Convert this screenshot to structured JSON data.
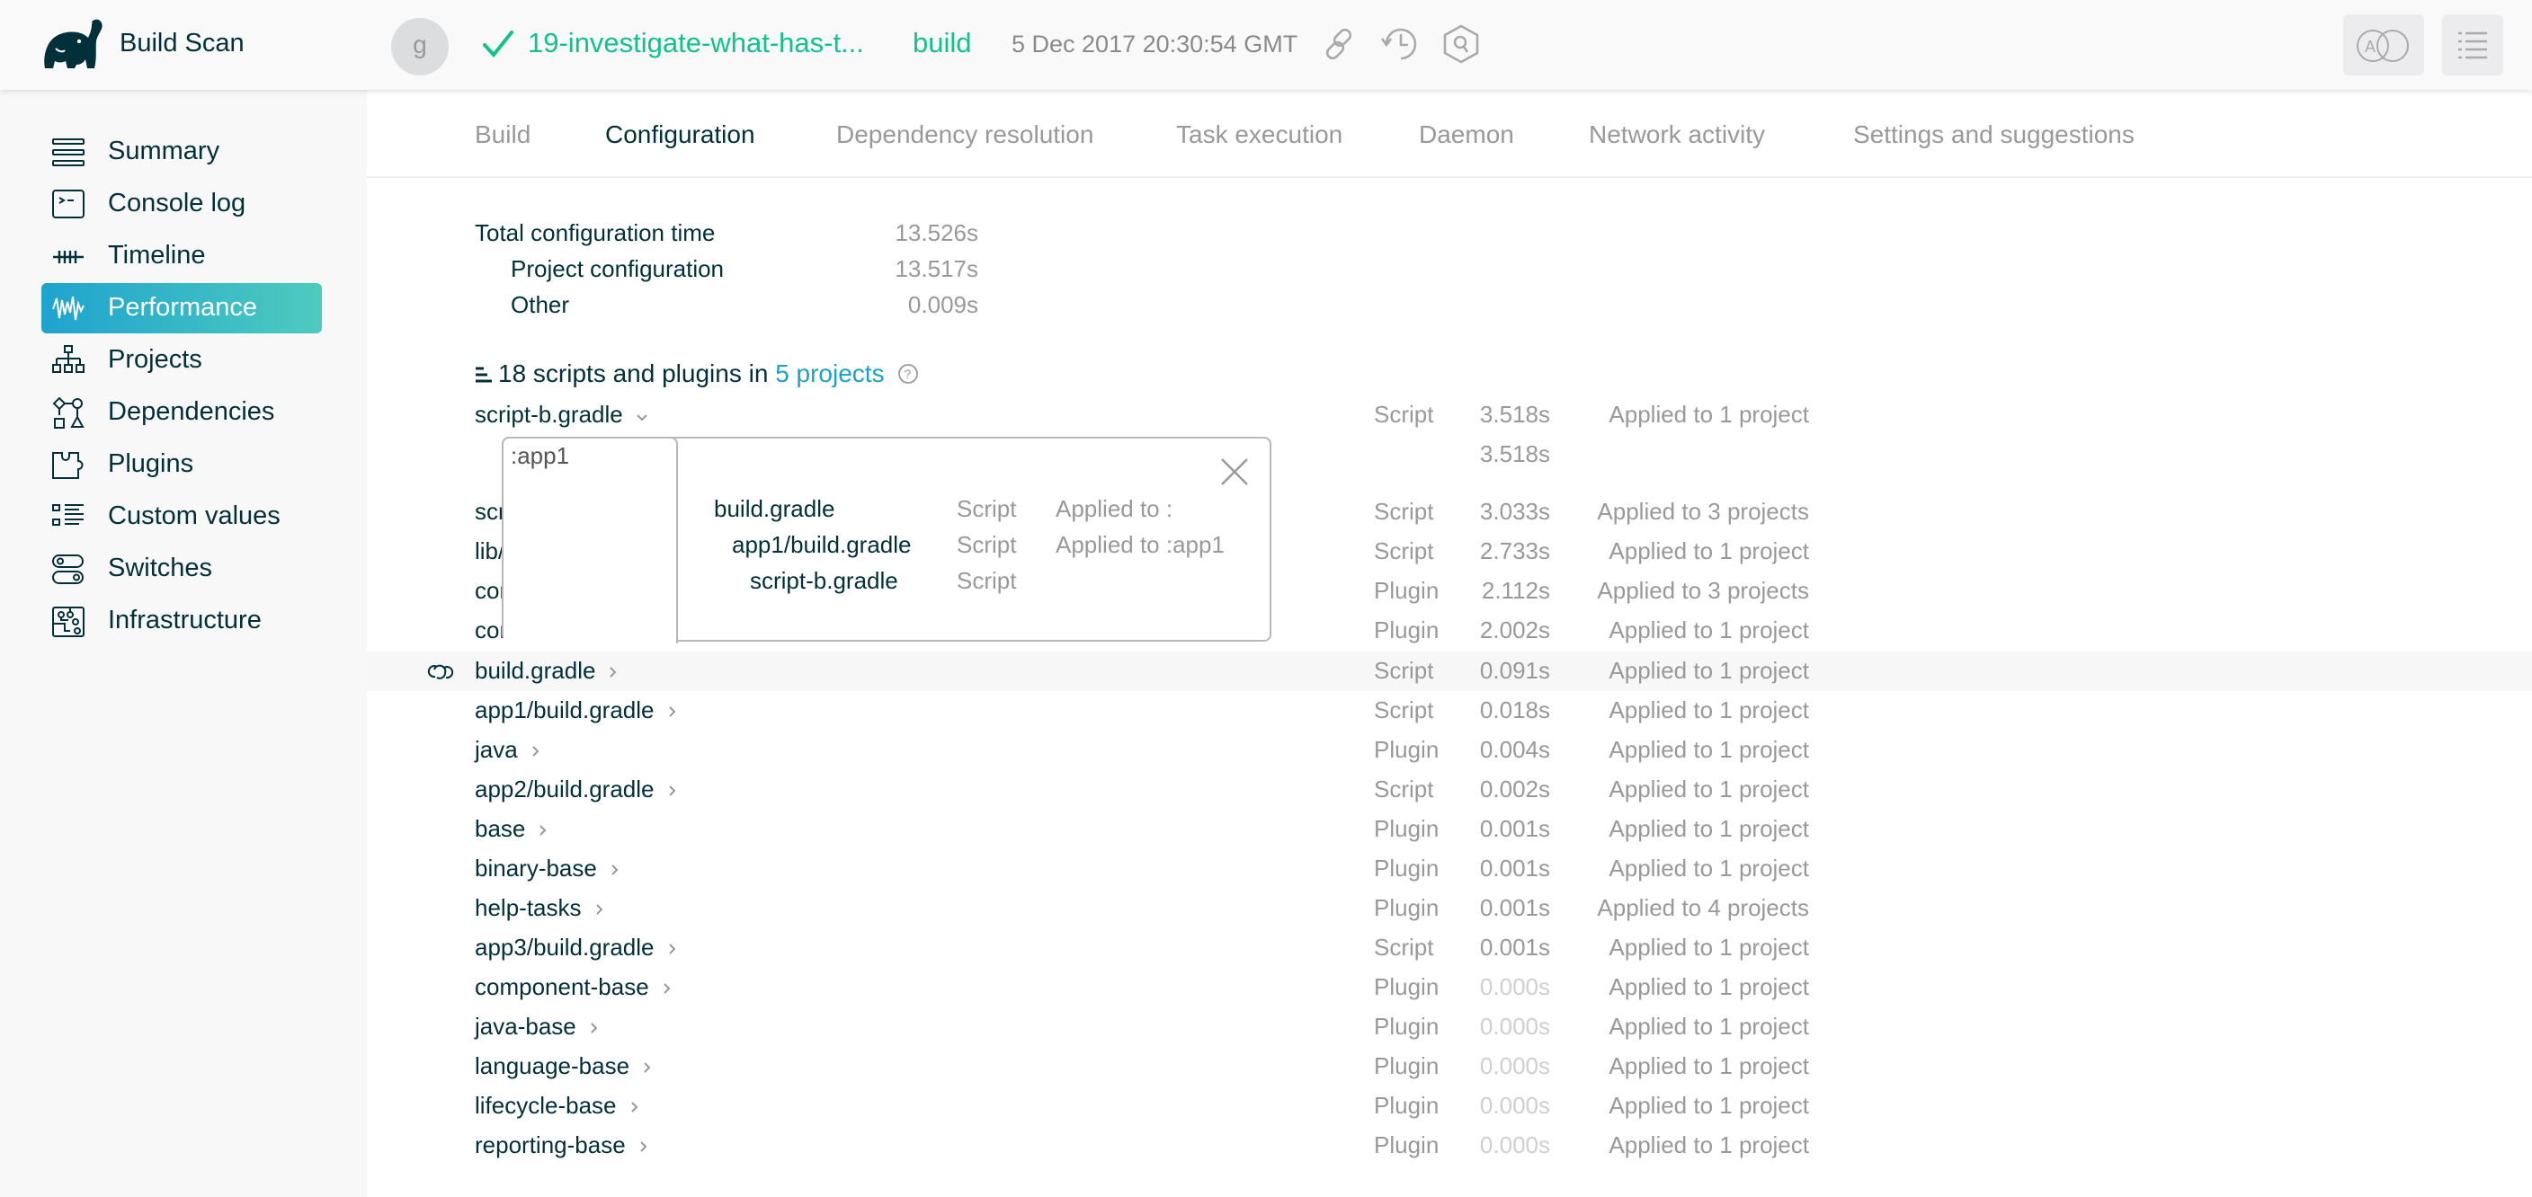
{
  "header": {
    "app_title": "Build Scan",
    "avatar_initial": "g",
    "build_status": "success",
    "build_name": "19-investigate-what-has-t...",
    "build_task": "build",
    "build_date": "5 Dec 2017 20:30:54 GMT",
    "icons": [
      "link-icon",
      "history-icon",
      "inspect-icon"
    ],
    "right_buttons": [
      "compare-icon",
      "outline-icon"
    ],
    "accent_color": "#12c28d"
  },
  "sidebar": {
    "items": [
      {
        "label": "Summary",
        "icon": "summary-icon",
        "active": false
      },
      {
        "label": "Console log",
        "icon": "console-icon",
        "active": false
      },
      {
        "label": "Timeline",
        "icon": "timeline-icon",
        "active": false
      },
      {
        "label": "Performance",
        "icon": "performance-icon",
        "active": true
      },
      {
        "label": "Projects",
        "icon": "projects-icon",
        "active": false
      },
      {
        "label": "Dependencies",
        "icon": "dependencies-icon",
        "active": false
      },
      {
        "label": "Plugins",
        "icon": "plugins-icon",
        "active": false
      },
      {
        "label": "Custom values",
        "icon": "custom-values-icon",
        "active": false
      },
      {
        "label": "Switches",
        "icon": "switches-icon",
        "active": false
      },
      {
        "label": "Infrastructure",
        "icon": "infrastructure-icon",
        "active": false
      }
    ]
  },
  "tabs": [
    {
      "label": "Build",
      "active": false
    },
    {
      "label": "Configuration",
      "active": true
    },
    {
      "label": "Dependency resolution",
      "active": false
    },
    {
      "label": "Task execution",
      "active": false
    },
    {
      "label": "Daemon",
      "active": false
    },
    {
      "label": "Network activity",
      "active": false
    },
    {
      "label": "Settings and suggestions",
      "active": false
    }
  ],
  "summary": {
    "total_label": "Total configuration time",
    "total_value": "13.526s",
    "project_label": "Project configuration",
    "project_value": "13.517s",
    "other_label": "Other",
    "other_value": "0.009s"
  },
  "section": {
    "count_text": "18 scripts and plugins",
    "in_text": " in ",
    "projects_link": "5 projects"
  },
  "expanded": {
    "name": "script-b.gradle",
    "type": "Script",
    "time": "3.518s",
    "applied": "Applied to 1 project",
    "project_tab": ":app1",
    "project_time": "3.518s",
    "popup": [
      {
        "name": "build.gradle",
        "type": "Script",
        "applied": "Applied to :"
      },
      {
        "name": "app1/build.gradle",
        "type": "Script",
        "applied": "Applied to :app1"
      },
      {
        "name": "script-b.gradle",
        "type": "Script",
        "applied": ""
      }
    ]
  },
  "rows": [
    {
      "name": "script-a.gradle",
      "type": "Script",
      "time": "3.033s",
      "applied": "Applied to 3 projects"
    },
    {
      "name": "lib/build.gradle",
      "type": "Script",
      "time": "2.733s",
      "applied": "Applied to 1 project"
    },
    {
      "name": "com.example.foo",
      "type": "Plugin",
      "time": "2.112s",
      "applied": "Applied to 3 projects"
    },
    {
      "name": "com.example.bar",
      "type": "Plugin",
      "time": "2.002s",
      "applied": "Applied to 1 project"
    },
    {
      "name": "build.gradle",
      "type": "Script",
      "time": "0.091s",
      "applied": "Applied to 1 project",
      "hover": true
    },
    {
      "name": "app1/build.gradle",
      "type": "Script",
      "time": "0.018s",
      "applied": "Applied to 1 project"
    },
    {
      "name": "java",
      "type": "Plugin",
      "time": "0.004s",
      "applied": "Applied to 1 project"
    },
    {
      "name": "app2/build.gradle",
      "type": "Script",
      "time": "0.002s",
      "applied": "Applied to 1 project"
    },
    {
      "name": "base",
      "type": "Plugin",
      "time": "0.001s",
      "applied": "Applied to 1 project"
    },
    {
      "name": "binary-base",
      "type": "Plugin",
      "time": "0.001s",
      "applied": "Applied to 1 project"
    },
    {
      "name": "help-tasks",
      "type": "Plugin",
      "time": "0.001s",
      "applied": "Applied to 4 projects"
    },
    {
      "name": "app3/build.gradle",
      "type": "Script",
      "time": "0.001s",
      "applied": "Applied to 1 project"
    },
    {
      "name": "component-base",
      "type": "Plugin",
      "time": "0.000s",
      "applied": "Applied to 1 project"
    },
    {
      "name": "java-base",
      "type": "Plugin",
      "time": "0.000s",
      "applied": "Applied to 1 project"
    },
    {
      "name": "language-base",
      "type": "Plugin",
      "time": "0.000s",
      "applied": "Applied to 1 project"
    },
    {
      "name": "lifecycle-base",
      "type": "Plugin",
      "time": "0.000s",
      "applied": "Applied to 1 project"
    },
    {
      "name": "reporting-base",
      "type": "Plugin",
      "time": "0.000s",
      "applied": "Applied to 1 project"
    }
  ]
}
